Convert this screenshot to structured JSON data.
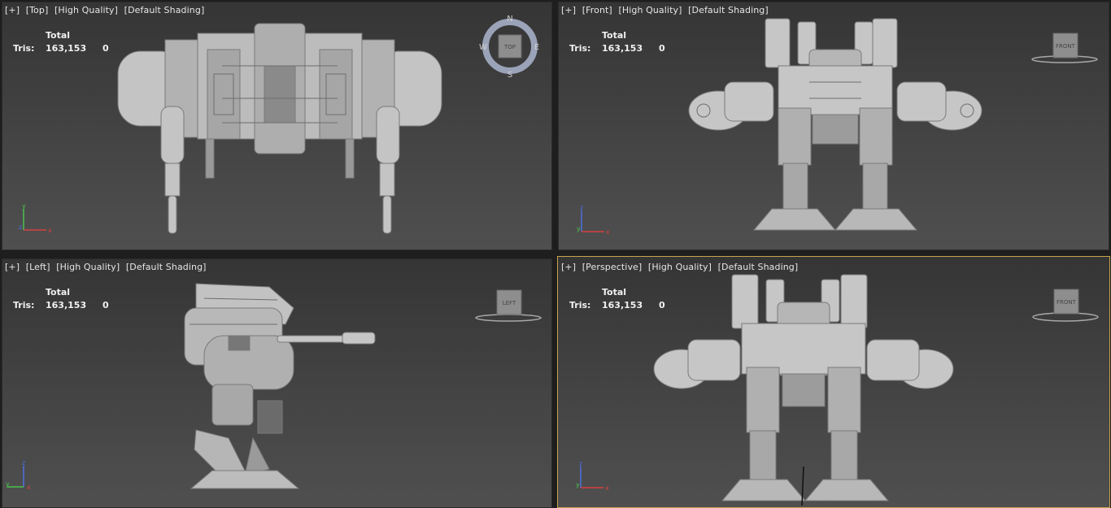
{
  "viewports": [
    {
      "id": "top",
      "label_parts": [
        "[+]",
        "[Top]",
        "[High Quality]",
        "[Default Shading]"
      ],
      "stats": {
        "total_label": "Total",
        "tris_label": "Tris:",
        "tris_total": "163,153",
        "tris_selected": "0"
      },
      "viewcube": {
        "type": "compass",
        "face": "TOP",
        "n": "N",
        "s": "S",
        "e": "E",
        "w": "W"
      },
      "axis": [
        "y",
        "z",
        "x"
      ]
    },
    {
      "id": "front",
      "label_parts": [
        "[+]",
        "[Front]",
        "[High Quality]",
        "[Default Shading]"
      ],
      "stats": {
        "total_label": "Total",
        "tris_label": "Tris:",
        "tris_total": "163,153",
        "tris_selected": "0"
      },
      "viewcube": {
        "type": "cube",
        "face": "FRONT"
      },
      "axis": [
        "z",
        "y",
        "x"
      ]
    },
    {
      "id": "left",
      "label_parts": [
        "[+]",
        "[Left]",
        "[High Quality]",
        "[Default Shading]"
      ],
      "stats": {
        "total_label": "Total",
        "tris_label": "Tris:",
        "tris_total": "163,153",
        "tris_selected": "0"
      },
      "viewcube": {
        "type": "cube",
        "face": "LEFT"
      },
      "axis": [
        "z",
        "y",
        "x"
      ]
    },
    {
      "id": "perspective",
      "label_parts": [
        "[+]",
        "[Perspective]",
        "[High Quality]",
        "[Default Shading]"
      ],
      "stats": {
        "total_label": "Total",
        "tris_label": "Tris:",
        "tris_total": "163,153",
        "tris_selected": "0"
      },
      "viewcube": {
        "type": "cube",
        "face": "FRONT"
      },
      "axis": [
        "z",
        "y",
        "x"
      ],
      "active": true
    }
  ],
  "colors": {
    "active_border": "#c7a44a",
    "axis_x": "#d94040",
    "axis_y": "#4cc24c",
    "axis_z": "#4d6fe0",
    "model": "#bdbdbd"
  }
}
